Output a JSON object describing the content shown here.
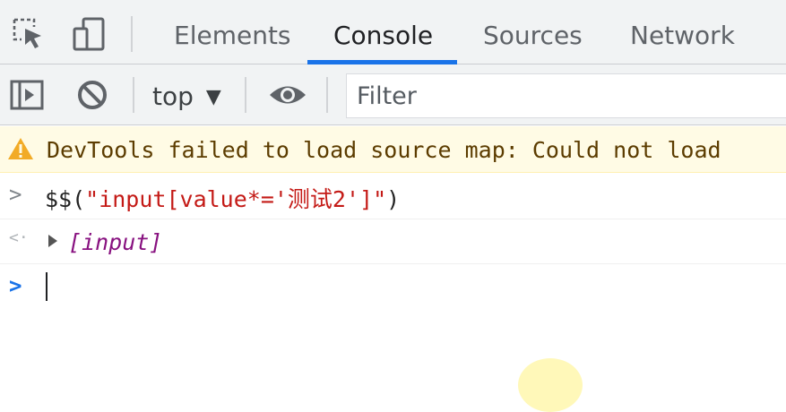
{
  "tabs": [
    {
      "label": "Elements"
    },
    {
      "label": "Console"
    },
    {
      "label": "Sources"
    },
    {
      "label": "Network"
    }
  ],
  "active_tab": "Console",
  "toolbar": {
    "context_label": "top",
    "context_arrow": "▼",
    "filter_placeholder": "Filter"
  },
  "console": {
    "warning": "DevTools failed to load source map: Could not load",
    "command_prefix": "$$(",
    "command_string": "\"input[value*='测试2']\"",
    "command_suffix": ")",
    "result": "[input]",
    "input_glyph": ">",
    "result_glyph": "<·"
  },
  "icons": {
    "inspect": "inspect-element-icon",
    "device": "device-toolbar-icon",
    "sidebar": "show-sidebar-icon",
    "clear": "clear-console-icon",
    "eye": "live-expression-icon",
    "warning": "warning-icon"
  },
  "colors": {
    "accent": "#1a73e8",
    "string": "#c41a16",
    "object": "#881280",
    "warning_bg": "#fffbe5",
    "warning_icon": "#f2ab26"
  }
}
